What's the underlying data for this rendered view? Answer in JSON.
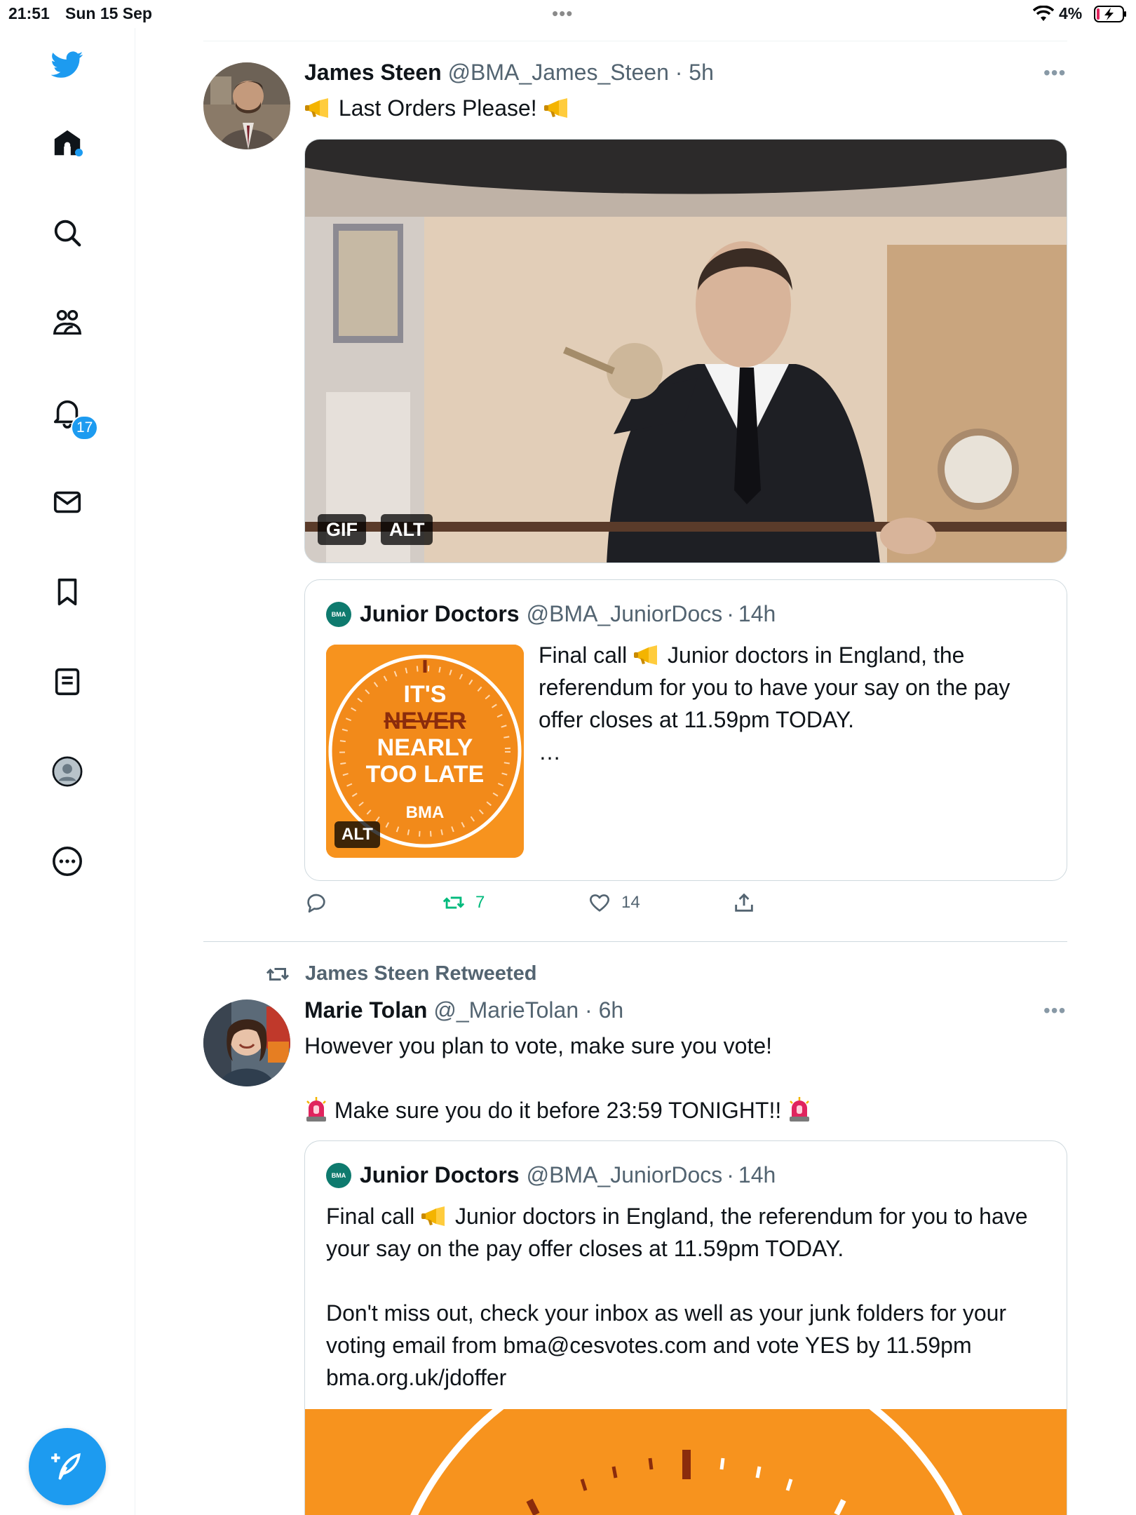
{
  "status_bar": {
    "time": "21:51",
    "date": "Sun 15 Sep",
    "battery": "4%"
  },
  "sidebar": {
    "items": [
      {
        "name": "home",
        "icon": "home-icon"
      },
      {
        "name": "explore",
        "icon": "search-icon"
      },
      {
        "name": "communities",
        "icon": "communities-icon"
      },
      {
        "name": "notifications",
        "icon": "bell-icon"
      },
      {
        "name": "messages",
        "icon": "mail-icon"
      },
      {
        "name": "bookmarks",
        "icon": "bookmark-icon"
      },
      {
        "name": "lists",
        "icon": "list-icon"
      },
      {
        "name": "profile",
        "icon": "profile-icon"
      },
      {
        "name": "more",
        "icon": "more-icon"
      }
    ],
    "notification_count": "17",
    "accent": "#1d9bf0"
  },
  "tweets": [
    {
      "name": "James Steen",
      "handle": "@BMA_James_Steen",
      "sep": "·",
      "time": "5h",
      "text": "Last Orders Please!",
      "media_badges": [
        "GIF",
        "ALT"
      ],
      "quote": {
        "name": "Junior Doctors",
        "handle": "@BMA_JuniorDocs",
        "sep": "·",
        "time": "14h",
        "text_prefix": "Final call",
        "text_rest": "Junior doctors in England, the referendum for you to have your say on the pay offer closes at 11.59pm TODAY.",
        "ellipsis": "…",
        "thumb": {
          "line1": "IT'S",
          "line2": "NEVER",
          "line3": "NEARLY",
          "line4": "TOO LATE",
          "brand": "BMA",
          "alt": "ALT"
        }
      },
      "actions": {
        "reply": "",
        "retweets": "7",
        "likes": "14"
      }
    },
    {
      "retweeted_by": "James Steen Retweeted",
      "name": "Marie Tolan",
      "handle": "@_MarieTolan",
      "sep": "·",
      "time": "6h",
      "text_line1": "However you plan to vote, make sure you vote!",
      "text_line2": "Make sure you do it before 23:59 TONIGHT!!",
      "quote": {
        "name": "Junior Doctors",
        "handle": "@BMA_JuniorDocs",
        "sep": "·",
        "time": "14h",
        "text_prefix": "Final call",
        "text_p1_rest": "Junior doctors in England, the referendum for you to have your say on the pay offer closes at 11.59pm TODAY.",
        "text_p2": "Don't miss out, check your inbox as well as your junk folders for your voting email from bma@cesvotes.com and vote YES by 11.59pm bma.org.uk/jdoffer"
      }
    }
  ]
}
